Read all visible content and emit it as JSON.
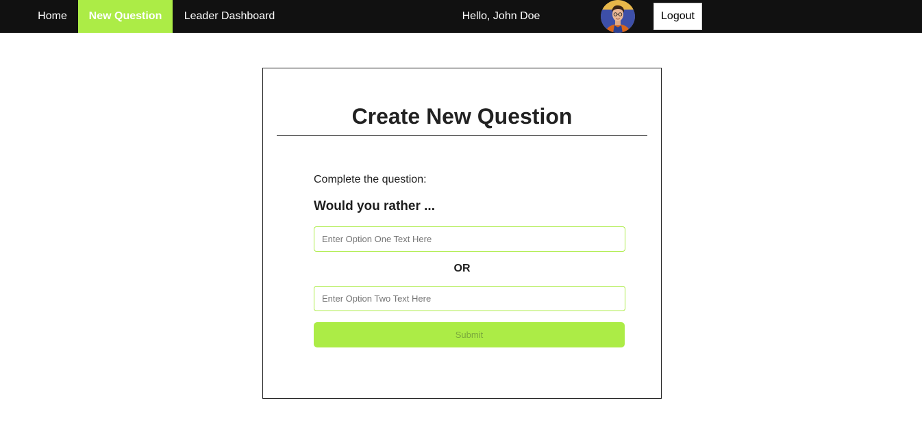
{
  "nav": {
    "items": [
      {
        "label": "Home",
        "active": false
      },
      {
        "label": "New Question",
        "active": true
      },
      {
        "label": "Leader Dashboard",
        "active": false
      }
    ],
    "greeting": "Hello, John Doe",
    "logout_label": "Logout",
    "avatar_icon": "user-avatar-icon"
  },
  "form": {
    "title": "Create New Question",
    "prompt": "Complete the question:",
    "lead": "Would you rather ...",
    "option_one": {
      "value": "",
      "placeholder": "Enter Option One Text Here"
    },
    "or_label": "OR",
    "option_two": {
      "value": "",
      "placeholder": "Enter Option Two Text Here"
    },
    "submit_label": "Submit"
  },
  "colors": {
    "navbar_bg": "#111111",
    "accent": "#acec46",
    "submit_text_disabled": "#7aa83c"
  }
}
